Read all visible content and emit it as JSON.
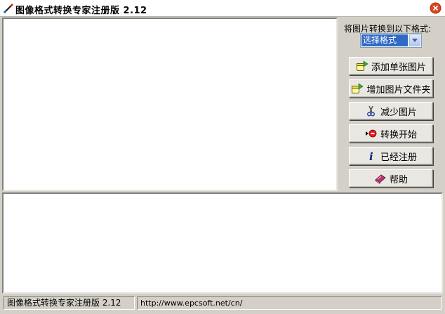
{
  "window": {
    "title": "图像格式转换专家注册版 2.12",
    "close_icon": "close-icon",
    "app_icon": "pen-wand-icon"
  },
  "panel": {
    "format_label": "将图片转换到以下格式:",
    "format_select": {
      "selected": "选择格式"
    },
    "buttons": [
      {
        "label": "添加单张图片",
        "icon": "add-image-icon"
      },
      {
        "label": "增加图片文件夹",
        "icon": "add-folder-icon"
      },
      {
        "label": "减少图片",
        "icon": "scissors-icon"
      },
      {
        "label": "转换开始",
        "icon": "record-start-icon"
      },
      {
        "label": "已经注册",
        "icon": "info-icon"
      },
      {
        "label": "帮助",
        "icon": "help-book-icon"
      }
    ]
  },
  "statusbar": {
    "app_name": "图像格式转换专家注册版 2.12",
    "url": "http://www.epcsoft.net/cn/"
  },
  "colors": {
    "face": "#d4d0c8",
    "selection": "#316ac5",
    "close_red": "#e0461f"
  }
}
